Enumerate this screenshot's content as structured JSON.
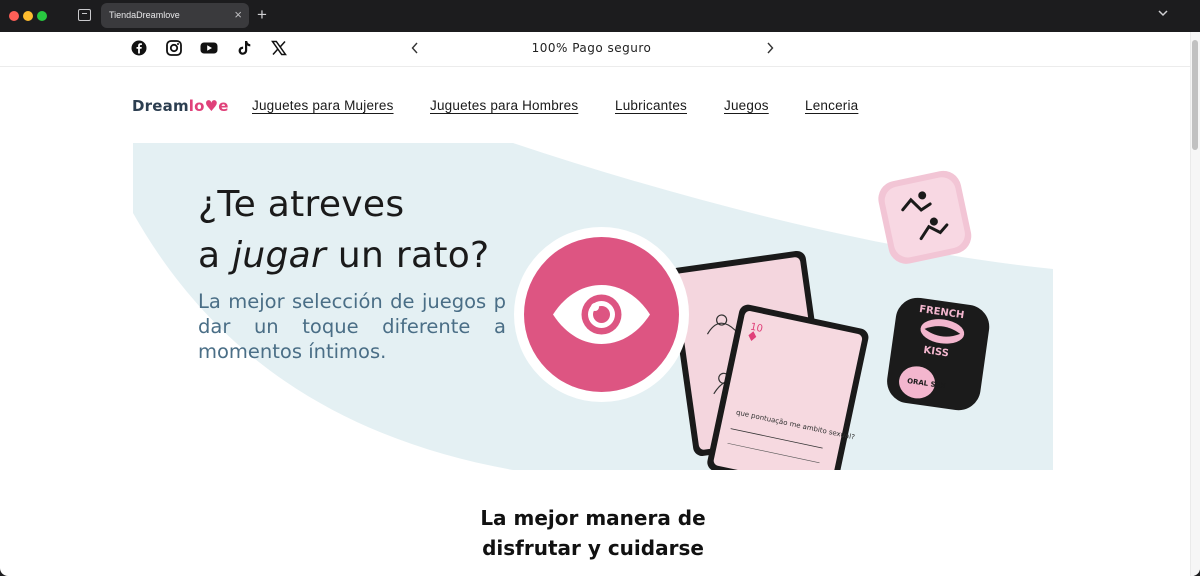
{
  "browser": {
    "tab_title": "TiendaDreamlove",
    "tab_close": "×",
    "new_tab": "+"
  },
  "topbar": {
    "social_icons": [
      "facebook-icon",
      "instagram-icon",
      "youtube-icon",
      "tiktok-icon",
      "x-icon"
    ],
    "announcement": "100% Pago seguro"
  },
  "header": {
    "logo_main": "Dream",
    "logo_accent": "lo",
    "logo_heart": "♥",
    "logo_end": "e",
    "nav": [
      "Juguetes para Mujeres",
      "Juguetes para Hombres",
      "Lubricantes",
      "Juegos",
      "Lenceria"
    ]
  },
  "hero": {
    "title_line1": "¿Te atreves",
    "title_line2_pre": "a ",
    "title_line2_em": "jugar",
    "title_line2_post": " un rato?",
    "subtitle": "La mejor selección de juegos p dar un toque diferente a momentos íntimos.",
    "die_text_top": "FRENCH",
    "die_text_bottom": "KISS",
    "die_text_side": "ORAL SEX",
    "card_number": "10",
    "card_text": "que pontuação me ambito sexual?"
  },
  "section": {
    "title_line1": "La mejor manera de",
    "title_line2": "disfrutar y cuidarse"
  },
  "colors": {
    "brand_pink": "#e0417a",
    "eye_pink": "#dd5582",
    "hero_band": "#e4f0f3",
    "subtitle_blue": "#4a6e86"
  }
}
